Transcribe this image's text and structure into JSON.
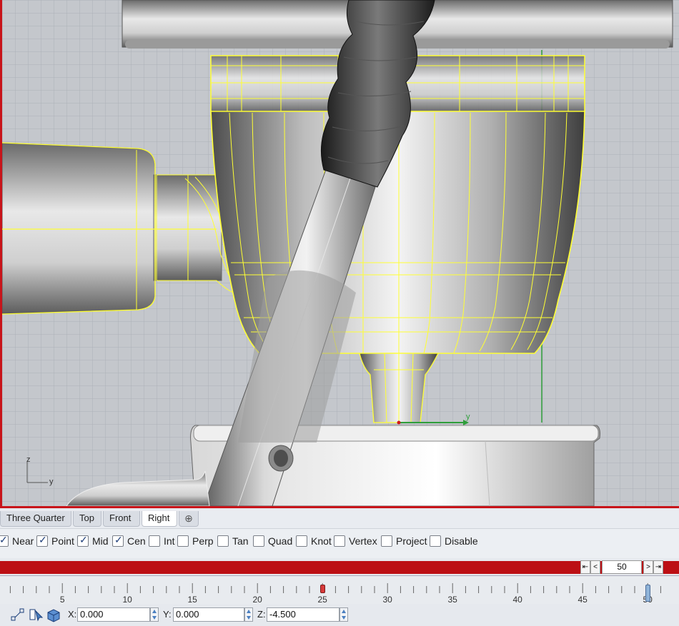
{
  "viewport": {
    "axis_labels": {
      "vertical": "z",
      "horizontal": "y",
      "gizmo_y": "y"
    }
  },
  "tabs": [
    {
      "label": "Three Quarter",
      "active": false
    },
    {
      "label": "Top",
      "active": false
    },
    {
      "label": "Front",
      "active": false
    },
    {
      "label": "Right",
      "active": true
    }
  ],
  "add_tab_icon": "plus-icon",
  "osnap": [
    {
      "label": "Near",
      "checked": true
    },
    {
      "label": "Point",
      "checked": true
    },
    {
      "label": "Mid",
      "checked": true
    },
    {
      "label": "Cen",
      "checked": true
    },
    {
      "label": "Int",
      "checked": false
    },
    {
      "label": "Perp",
      "checked": false
    },
    {
      "label": "Tan",
      "checked": false
    },
    {
      "label": "Quad",
      "checked": false
    },
    {
      "label": "Knot",
      "checked": false
    },
    {
      "label": "Vertex",
      "checked": false
    },
    {
      "label": "Project",
      "checked": false
    },
    {
      "label": "Disable",
      "checked": false
    }
  ],
  "frame_control": {
    "first": "⇤",
    "prev": "<",
    "value": "50",
    "next": ">",
    "last": "⇥"
  },
  "timeline": {
    "ticks": [
      "5",
      "10",
      "15",
      "20",
      "25",
      "30",
      "35",
      "40",
      "45",
      "50"
    ],
    "current_frame": 50,
    "marker_frame": 25
  },
  "status": {
    "x_label": "X:",
    "x_value": "0.000",
    "y_label": "Y:",
    "y_value": "0.000",
    "z_label": "Z:",
    "z_value": "-4.500",
    "icons": [
      "control-points-icon",
      "pointer-tool-icon",
      "box-object-icon"
    ]
  },
  "colors": {
    "viewport_bg": "#c4c7cc",
    "grid_line": "#aeb2b8",
    "selection_yellow": "#ffff33",
    "active_border": "#c8141a",
    "y_axis_green": "#2e9e3a"
  }
}
